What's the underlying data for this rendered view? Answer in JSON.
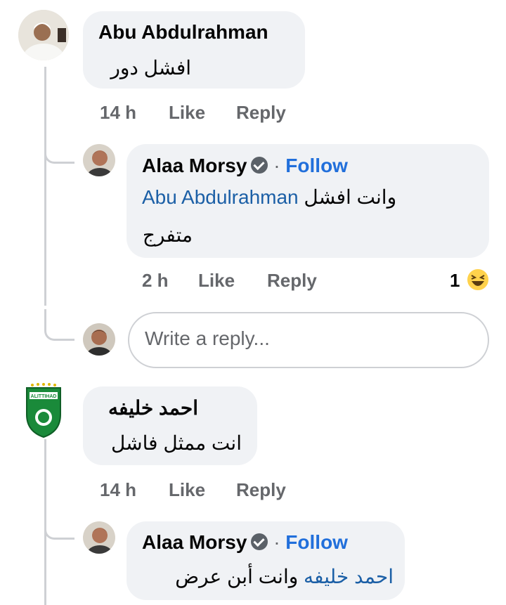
{
  "comments": [
    {
      "author": "Abu Abdulrahman",
      "text": "افشل دور",
      "time": "14 h",
      "like": "Like",
      "reply": "Reply",
      "replies": [
        {
          "author": "Alaa Morsy",
          "follow": "Follow",
          "mention": "Abu Abdulrahman",
          "text_line1": "وانت افشل",
          "text_line2": "متفرج",
          "time": "2 h",
          "like": "Like",
          "reply": "Reply",
          "reaction_count": "1"
        }
      ]
    },
    {
      "author": "احمد خليفه",
      "text": "انت ممثل فاشل",
      "time": "14 h",
      "like": "Like",
      "reply": "Reply",
      "replies": [
        {
          "author": "Alaa Morsy",
          "follow": "Follow",
          "mention": "احمد خليفه",
          "text": "وانت أبن عرض"
        }
      ]
    }
  ],
  "reply_input": {
    "placeholder": "Write a reply..."
  },
  "avatar_badge_text": "ALITTIHAD",
  "colors": {
    "bubble": "#f0f2f5",
    "follow": "#216fdb",
    "meta": "#65676b",
    "club_green": "#1a8a3a"
  }
}
